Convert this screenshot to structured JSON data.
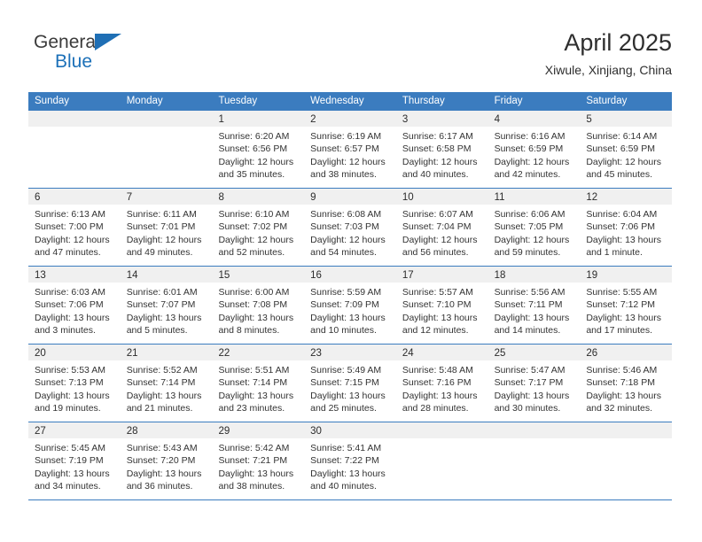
{
  "brand": {
    "word_one": "General",
    "word_two": "Blue",
    "flag_icon": "triangle-flag-icon"
  },
  "header": {
    "title": "April 2025",
    "subtitle": "Xiwule, Xinjiang, China"
  },
  "calendar": {
    "weekday_headers": [
      "Sunday",
      "Monday",
      "Tuesday",
      "Wednesday",
      "Thursday",
      "Friday",
      "Saturday"
    ],
    "colors": {
      "header_blue": "#3b7cbf",
      "daynum_band": "#f0f0f0",
      "text": "#333333",
      "brand_blue": "#1c70b8"
    },
    "weeks": [
      [
        {
          "day": "",
          "sunrise": "",
          "sunset": "",
          "daylight_line1": "",
          "daylight_line2": ""
        },
        {
          "day": "",
          "sunrise": "",
          "sunset": "",
          "daylight_line1": "",
          "daylight_line2": ""
        },
        {
          "day": "1",
          "sunrise": "Sunrise: 6:20 AM",
          "sunset": "Sunset: 6:56 PM",
          "daylight_line1": "Daylight: 12 hours",
          "daylight_line2": "and 35 minutes."
        },
        {
          "day": "2",
          "sunrise": "Sunrise: 6:19 AM",
          "sunset": "Sunset: 6:57 PM",
          "daylight_line1": "Daylight: 12 hours",
          "daylight_line2": "and 38 minutes."
        },
        {
          "day": "3",
          "sunrise": "Sunrise: 6:17 AM",
          "sunset": "Sunset: 6:58 PM",
          "daylight_line1": "Daylight: 12 hours",
          "daylight_line2": "and 40 minutes."
        },
        {
          "day": "4",
          "sunrise": "Sunrise: 6:16 AM",
          "sunset": "Sunset: 6:59 PM",
          "daylight_line1": "Daylight: 12 hours",
          "daylight_line2": "and 42 minutes."
        },
        {
          "day": "5",
          "sunrise": "Sunrise: 6:14 AM",
          "sunset": "Sunset: 6:59 PM",
          "daylight_line1": "Daylight: 12 hours",
          "daylight_line2": "and 45 minutes."
        }
      ],
      [
        {
          "day": "6",
          "sunrise": "Sunrise: 6:13 AM",
          "sunset": "Sunset: 7:00 PM",
          "daylight_line1": "Daylight: 12 hours",
          "daylight_line2": "and 47 minutes."
        },
        {
          "day": "7",
          "sunrise": "Sunrise: 6:11 AM",
          "sunset": "Sunset: 7:01 PM",
          "daylight_line1": "Daylight: 12 hours",
          "daylight_line2": "and 49 minutes."
        },
        {
          "day": "8",
          "sunrise": "Sunrise: 6:10 AM",
          "sunset": "Sunset: 7:02 PM",
          "daylight_line1": "Daylight: 12 hours",
          "daylight_line2": "and 52 minutes."
        },
        {
          "day": "9",
          "sunrise": "Sunrise: 6:08 AM",
          "sunset": "Sunset: 7:03 PM",
          "daylight_line1": "Daylight: 12 hours",
          "daylight_line2": "and 54 minutes."
        },
        {
          "day": "10",
          "sunrise": "Sunrise: 6:07 AM",
          "sunset": "Sunset: 7:04 PM",
          "daylight_line1": "Daylight: 12 hours",
          "daylight_line2": "and 56 minutes."
        },
        {
          "day": "11",
          "sunrise": "Sunrise: 6:06 AM",
          "sunset": "Sunset: 7:05 PM",
          "daylight_line1": "Daylight: 12 hours",
          "daylight_line2": "and 59 minutes."
        },
        {
          "day": "12",
          "sunrise": "Sunrise: 6:04 AM",
          "sunset": "Sunset: 7:06 PM",
          "daylight_line1": "Daylight: 13 hours",
          "daylight_line2": "and 1 minute."
        }
      ],
      [
        {
          "day": "13",
          "sunrise": "Sunrise: 6:03 AM",
          "sunset": "Sunset: 7:06 PM",
          "daylight_line1": "Daylight: 13 hours",
          "daylight_line2": "and 3 minutes."
        },
        {
          "day": "14",
          "sunrise": "Sunrise: 6:01 AM",
          "sunset": "Sunset: 7:07 PM",
          "daylight_line1": "Daylight: 13 hours",
          "daylight_line2": "and 5 minutes."
        },
        {
          "day": "15",
          "sunrise": "Sunrise: 6:00 AM",
          "sunset": "Sunset: 7:08 PM",
          "daylight_line1": "Daylight: 13 hours",
          "daylight_line2": "and 8 minutes."
        },
        {
          "day": "16",
          "sunrise": "Sunrise: 5:59 AM",
          "sunset": "Sunset: 7:09 PM",
          "daylight_line1": "Daylight: 13 hours",
          "daylight_line2": "and 10 minutes."
        },
        {
          "day": "17",
          "sunrise": "Sunrise: 5:57 AM",
          "sunset": "Sunset: 7:10 PM",
          "daylight_line1": "Daylight: 13 hours",
          "daylight_line2": "and 12 minutes."
        },
        {
          "day": "18",
          "sunrise": "Sunrise: 5:56 AM",
          "sunset": "Sunset: 7:11 PM",
          "daylight_line1": "Daylight: 13 hours",
          "daylight_line2": "and 14 minutes."
        },
        {
          "day": "19",
          "sunrise": "Sunrise: 5:55 AM",
          "sunset": "Sunset: 7:12 PM",
          "daylight_line1": "Daylight: 13 hours",
          "daylight_line2": "and 17 minutes."
        }
      ],
      [
        {
          "day": "20",
          "sunrise": "Sunrise: 5:53 AM",
          "sunset": "Sunset: 7:13 PM",
          "daylight_line1": "Daylight: 13 hours",
          "daylight_line2": "and 19 minutes."
        },
        {
          "day": "21",
          "sunrise": "Sunrise: 5:52 AM",
          "sunset": "Sunset: 7:14 PM",
          "daylight_line1": "Daylight: 13 hours",
          "daylight_line2": "and 21 minutes."
        },
        {
          "day": "22",
          "sunrise": "Sunrise: 5:51 AM",
          "sunset": "Sunset: 7:14 PM",
          "daylight_line1": "Daylight: 13 hours",
          "daylight_line2": "and 23 minutes."
        },
        {
          "day": "23",
          "sunrise": "Sunrise: 5:49 AM",
          "sunset": "Sunset: 7:15 PM",
          "daylight_line1": "Daylight: 13 hours",
          "daylight_line2": "and 25 minutes."
        },
        {
          "day": "24",
          "sunrise": "Sunrise: 5:48 AM",
          "sunset": "Sunset: 7:16 PM",
          "daylight_line1": "Daylight: 13 hours",
          "daylight_line2": "and 28 minutes."
        },
        {
          "day": "25",
          "sunrise": "Sunrise: 5:47 AM",
          "sunset": "Sunset: 7:17 PM",
          "daylight_line1": "Daylight: 13 hours",
          "daylight_line2": "and 30 minutes."
        },
        {
          "day": "26",
          "sunrise": "Sunrise: 5:46 AM",
          "sunset": "Sunset: 7:18 PM",
          "daylight_line1": "Daylight: 13 hours",
          "daylight_line2": "and 32 minutes."
        }
      ],
      [
        {
          "day": "27",
          "sunrise": "Sunrise: 5:45 AM",
          "sunset": "Sunset: 7:19 PM",
          "daylight_line1": "Daylight: 13 hours",
          "daylight_line2": "and 34 minutes."
        },
        {
          "day": "28",
          "sunrise": "Sunrise: 5:43 AM",
          "sunset": "Sunset: 7:20 PM",
          "daylight_line1": "Daylight: 13 hours",
          "daylight_line2": "and 36 minutes."
        },
        {
          "day": "29",
          "sunrise": "Sunrise: 5:42 AM",
          "sunset": "Sunset: 7:21 PM",
          "daylight_line1": "Daylight: 13 hours",
          "daylight_line2": "and 38 minutes."
        },
        {
          "day": "30",
          "sunrise": "Sunrise: 5:41 AM",
          "sunset": "Sunset: 7:22 PM",
          "daylight_line1": "Daylight: 13 hours",
          "daylight_line2": "and 40 minutes."
        },
        {
          "day": "",
          "sunrise": "",
          "sunset": "",
          "daylight_line1": "",
          "daylight_line2": ""
        },
        {
          "day": "",
          "sunrise": "",
          "sunset": "",
          "daylight_line1": "",
          "daylight_line2": ""
        },
        {
          "day": "",
          "sunrise": "",
          "sunset": "",
          "daylight_line1": "",
          "daylight_line2": ""
        }
      ]
    ]
  }
}
